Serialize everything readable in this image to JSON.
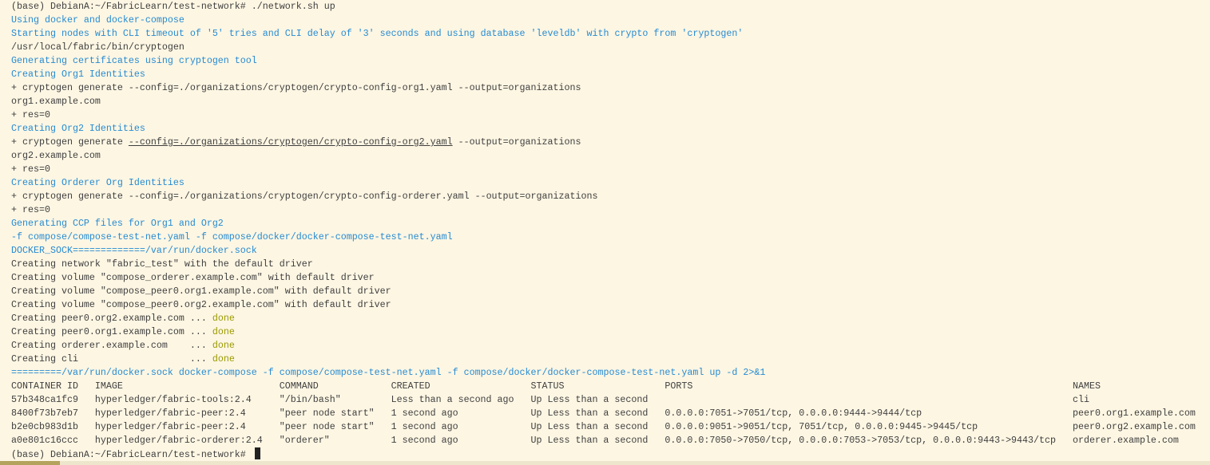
{
  "colors": {
    "background": "#fdf6e3",
    "text": "#3f3f3f",
    "info": "#268bd2",
    "done": "#9b9b00"
  },
  "lines": [
    "(base) DebianA:~/FabricLearn/test-network# ./network.sh up",
    "Using docker and docker-compose",
    "Starting nodes with CLI timeout of '5' tries and CLI delay of '3' seconds and using database 'leveldb' with crypto from 'cryptogen'",
    "/usr/local/fabric/bin/cryptogen",
    "Generating certificates using cryptogen tool",
    "Creating Org1 Identities",
    "+ cryptogen generate --config=./organizations/cryptogen/crypto-config-org1.yaml --output=organizations",
    "org1.example.com",
    "+ res=0",
    "Creating Org2 Identities",
    {
      "pre": "+ cryptogen generate ",
      "link": "--config=./organizations/cryptogen/crypto-config-org2.yaml",
      "post": " --output=organizations"
    },
    "org2.example.com",
    "+ res=0",
    "Creating Orderer Org Identities",
    "+ cryptogen generate --config=./organizations/cryptogen/crypto-config-orderer.yaml --output=organizations",
    "+ res=0",
    "Generating CCP files for Org1 and Org2",
    "-f compose/compose-test-net.yaml -f compose/docker/docker-compose-test-net.yaml",
    "DOCKER_SOCK=============/var/run/docker.sock",
    "Creating network \"fabric_test\" with the default driver",
    "Creating volume \"compose_orderer.example.com\" with default driver",
    "Creating volume \"compose_peer0.org1.example.com\" with default driver",
    "Creating volume \"compose_peer0.org2.example.com\" with default driver",
    {
      "pre": "Creating peer0.org2.example.com ... ",
      "status": "done"
    },
    {
      "pre": "Creating peer0.org1.example.com ... ",
      "status": "done"
    },
    {
      "pre": "Creating orderer.example.com    ... ",
      "status": "done"
    },
    {
      "pre": "Creating cli                    ... ",
      "status": "done"
    },
    "=========/var/run/docker.sock docker-compose -f compose/compose-test-net.yaml -f compose/docker/docker-compose-test-net.yaml up -d 2>&1"
  ],
  "table": {
    "headers": [
      "CONTAINER ID",
      "IMAGE",
      "COMMAND",
      "CREATED",
      "STATUS",
      "PORTS",
      "NAMES"
    ],
    "rows": [
      [
        "57b348ca1fc9",
        "hyperledger/fabric-tools:2.4",
        "\"/bin/bash\"",
        "Less than a second ago",
        "Up Less than a second",
        "",
        "cli"
      ],
      [
        "8400f73b7eb7",
        "hyperledger/fabric-peer:2.4",
        "\"peer node start\"",
        "1 second ago",
        "Up Less than a second",
        "0.0.0.0:7051->7051/tcp, 0.0.0.0:9444->9444/tcp",
        "peer0.org1.example.com"
      ],
      [
        "b2e0cb983d1b",
        "hyperledger/fabric-peer:2.4",
        "\"peer node start\"",
        "1 second ago",
        "Up Less than a second",
        "0.0.0.0:9051->9051/tcp, 7051/tcp, 0.0.0.0:9445->9445/tcp",
        "peer0.org2.example.com"
      ],
      [
        "a0e801c16ccc",
        "hyperledger/fabric-orderer:2.4",
        "\"orderer\"",
        "1 second ago",
        "Up Less than a second",
        "0.0.0.0:7050->7050/tcp, 0.0.0.0:7053->7053/tcp, 0.0.0.0:9443->9443/tcp",
        "orderer.example.com"
      ]
    ]
  },
  "prompt": "(base) DebianA:~/FabricLearn/test-network# "
}
